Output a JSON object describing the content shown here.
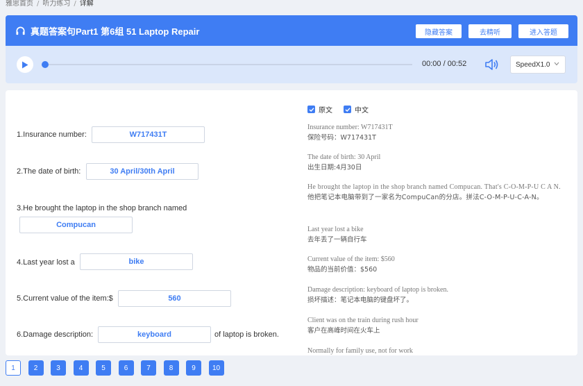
{
  "breadcrumb": [
    "雅思首页",
    "听力练习",
    "详解"
  ],
  "breadcrumb_sep": "/",
  "header": {
    "title": "真题答案句Part1 第6组 51 Laptop Repair",
    "buttons": [
      "隐藏答案",
      "去精听",
      "进入答题"
    ]
  },
  "player": {
    "time": "00:00 / 00:52",
    "speed": "SpeedX1.0",
    "progress": 0
  },
  "questions": [
    {
      "label": "1.Insurance number:",
      "answer": "W717431T"
    },
    {
      "label": "2.The date of birth:",
      "answer": "30 April/30th April"
    },
    {
      "label": "3.He brought the laptop in the shop branch named",
      "answer": "Compucan"
    },
    {
      "label": "4.Last year lost a",
      "answer": "bike"
    },
    {
      "label": "5.Current value of the item:$",
      "answer": "560"
    },
    {
      "label": "6.Damage description:",
      "answer": "keyboard",
      "suffix": "of laptop is broken."
    }
  ],
  "checks": [
    "原文",
    "中文"
  ],
  "transcript": [
    {
      "en": "Insurance number: W717431T",
      "zh": "保险号码：W717431T"
    },
    {
      "en": "The date of birth: 30 April",
      "zh": "出生日期:4月30日"
    },
    {
      "en": "He brought the laptop in the shop branch named Compucan. That's C-O-M-P-U C A N.",
      "zh": "他把笔记本电脑带到了一家名为CompuCan的分店。拼法C-O-M-P-U-C-A-N。"
    },
    {
      "en": "Last year lost a bike",
      "zh": "去年丢了一辆自行车"
    },
    {
      "en": "Current value of the item: $560",
      "zh": "物品的当前价值：$560"
    },
    {
      "en": "Damage description: keyboard of laptop is broken.",
      "zh": "损坏描述：笔记本电脑的键盘坏了。"
    },
    {
      "en": "Client was on the train during rush hour",
      "zh": "客户在高峰时间在火车上"
    },
    {
      "en": "Normally for family use, not for work",
      "zh": ""
    }
  ],
  "pages": [
    "1",
    "2",
    "3",
    "4",
    "5",
    "6",
    "7",
    "8",
    "9",
    "10"
  ],
  "colors": {
    "accent": "#3f7df3",
    "player_bg": "#dbe7fb",
    "page_bg": "#eef1f6"
  }
}
